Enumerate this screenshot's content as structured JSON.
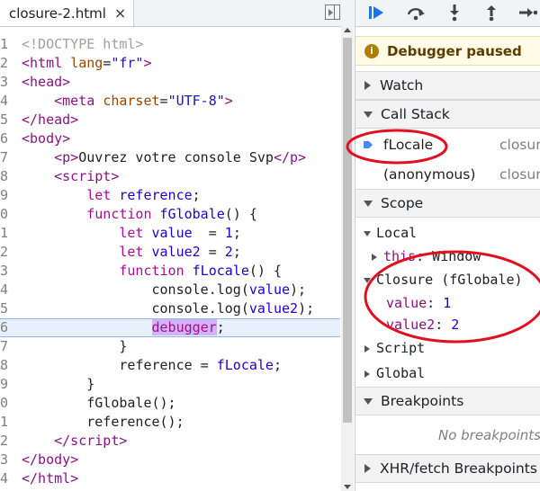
{
  "editor": {
    "tab_label": "closure-2.html",
    "tab_close": "×",
    "lines": [
      {
        "n": "1",
        "html": "<span class='c'>&lt;!DOCTYPE html&gt;</span>"
      },
      {
        "n": "2",
        "html": "<span class='t'>&lt;html</span> <span class='a'>lang</span><span class='p'>=</span><span class='s'>\"fr\"</span><span class='t'>&gt;</span>"
      },
      {
        "n": "3",
        "html": "<span class='t'>&lt;head&gt;</span>"
      },
      {
        "n": "4",
        "html": "    <span class='t'>&lt;meta</span> <span class='a'>charset</span><span class='p'>=</span><span class='s'>\"UTF-8\"</span><span class='t'>&gt;</span>"
      },
      {
        "n": "5",
        "html": "<span class='t'>&lt;/head&gt;</span>"
      },
      {
        "n": "6",
        "html": "<span class='t'>&lt;body&gt;</span>"
      },
      {
        "n": "7",
        "html": "    <span class='t'>&lt;p&gt;</span>Ouvrez votre console Svp<span class='t'>&lt;/p&gt;</span>"
      },
      {
        "n": "8",
        "html": "    <span class='t'>&lt;script&gt;</span>"
      },
      {
        "n": "9",
        "html": "        <span class='k'>let</span> <span class='v'>reference</span>;"
      },
      {
        "n": "0",
        "html": "        <span class='k'>function</span> <span class='f'>fGlobale</span>() {"
      },
      {
        "n": "1",
        "html": "            <span class='k'>let</span> <span class='v'>value</span>  = <span class='v'>1</span>;"
      },
      {
        "n": "2",
        "html": "            <span class='k'>let</span> <span class='v'>value2</span> = <span class='v'>2</span>;"
      },
      {
        "n": "3",
        "html": "            <span class='k'>function</span> <span class='f'>fLocale</span>() {"
      },
      {
        "n": "4",
        "html": "                console.log(<span class='v'>value</span>);"
      },
      {
        "n": "5",
        "html": "                console.log(<span class='v'>value2</span>);"
      },
      {
        "n": "6",
        "html": "                <span class='hl k'>debugger</span>;",
        "current": true
      },
      {
        "n": "7",
        "html": "            }"
      },
      {
        "n": "8",
        "html": "            reference = <span class='v'>fLocale</span>;"
      },
      {
        "n": "9",
        "html": "        }"
      },
      {
        "n": "0",
        "html": "        fGlobale();"
      },
      {
        "n": "1",
        "html": "        reference();"
      },
      {
        "n": "2",
        "html": "    <span class='t'>&lt;/script&gt;</span>"
      },
      {
        "n": "3",
        "html": "<span class='t'>&lt;/body&gt;</span>"
      },
      {
        "n": "4",
        "html": "<span class='t'>&lt;/html&gt;</span>"
      }
    ]
  },
  "debugger": {
    "toolbar_icons": [
      "resume-icon",
      "step-over-icon",
      "step-into-icon",
      "step-out-icon",
      "step-icon"
    ],
    "paused_icon": "i",
    "paused_text": "Debugger paused",
    "watch_label": "Watch",
    "call_stack_label": "Call Stack",
    "frames": [
      {
        "name": "fLocale",
        "location": "closure"
      },
      {
        "name": "(anonymous)",
        "location": "closure"
      }
    ],
    "scope_label": "Scope",
    "local_label": "Local",
    "this_key": "this",
    "this_val": ": Window",
    "closure_label": "Closure (fGlobale)",
    "vars": [
      {
        "name": "value",
        "value": "1"
      },
      {
        "name": "value2",
        "value": "2"
      }
    ],
    "script_label": "Script",
    "global_label": "Global",
    "breakpoints_label": "Breakpoints",
    "no_breakpoints": "No breakpoints",
    "xhr_label": "XHR/fetch Breakpoints"
  },
  "colors": {
    "annotation": "#e01020",
    "current_line": "#e8f0fe",
    "paused_bg": "#fffbe6"
  }
}
